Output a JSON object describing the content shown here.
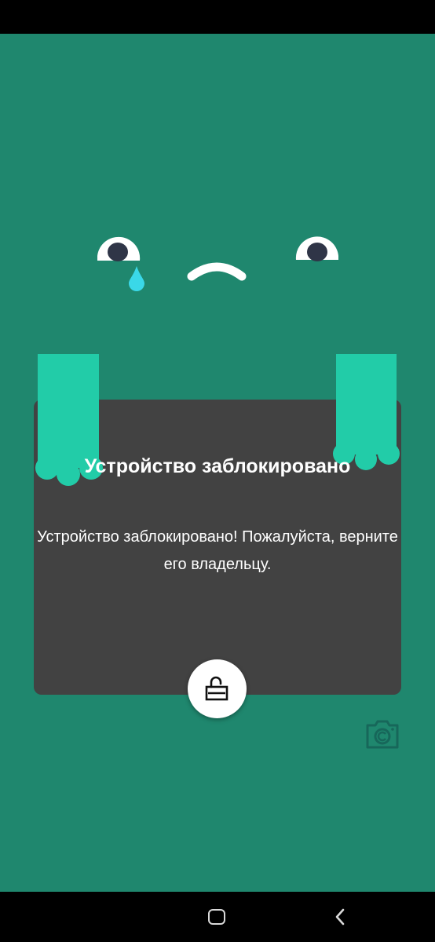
{
  "lock_screen": {
    "title": "Устройство заблокировано",
    "message": "Устройство заблокировано! Пожалуйста, верните его владельцу."
  },
  "colors": {
    "background": "#1f876e",
    "card": "#424242",
    "paw": "#22cca8",
    "tear": "#3ad8e8"
  },
  "icons": {
    "unlock": "unlock-icon",
    "camera": "camera-icon",
    "home": "home-icon",
    "back": "back-icon"
  }
}
